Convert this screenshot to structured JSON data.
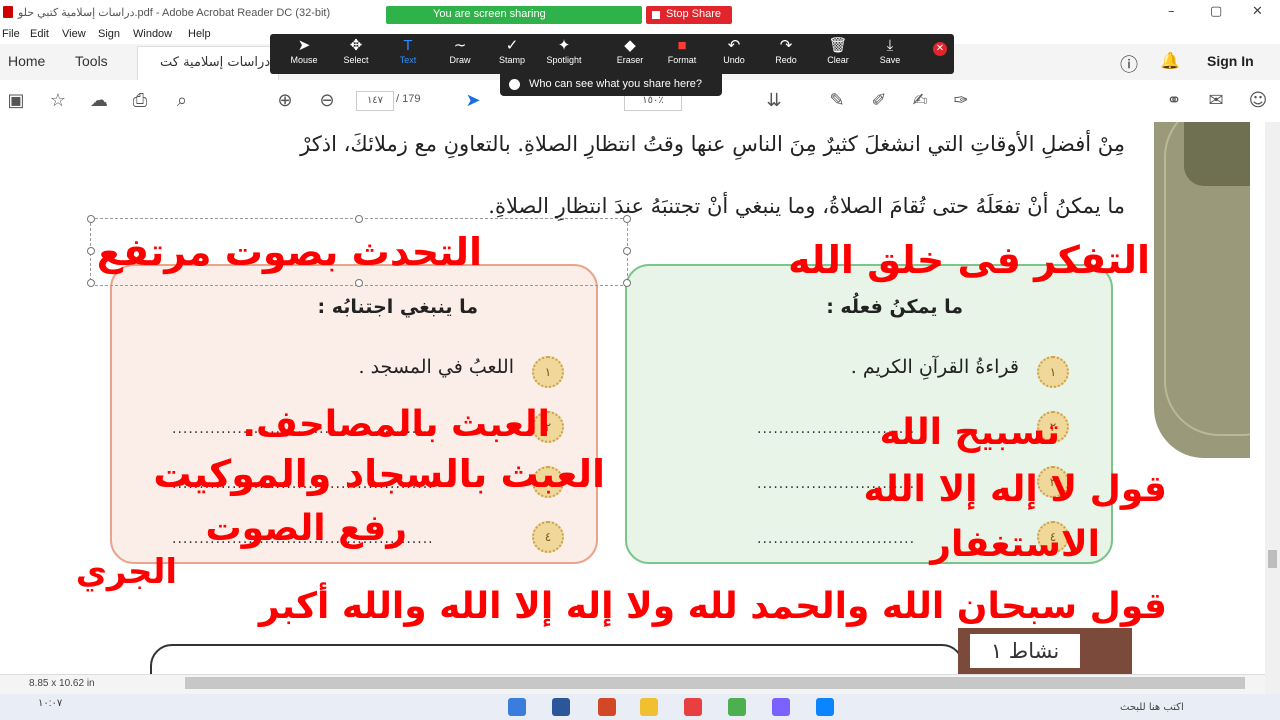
{
  "window": {
    "title": "دراسات إسلامية كتبي حلو.pdf - Adobe Acrobat Reader DC (32-bit)",
    "minimize": "–",
    "maximize": "▢",
    "close": "✕"
  },
  "share": {
    "banner": "You are screen sharing",
    "stop": "Stop Share",
    "who": "Who can see what you share here?"
  },
  "menu": [
    "File",
    "Edit",
    "View",
    "Sign",
    "Window",
    "Help"
  ],
  "tabs": {
    "home": "Home",
    "tools": "Tools",
    "document": "دراسات إسلامية كت...",
    "sign_in": "Sign In"
  },
  "annotation_tools": [
    {
      "label": "Mouse",
      "glyph": "➤",
      "icon": "mouse-pointer-icon"
    },
    {
      "label": "Select",
      "glyph": "✥",
      "icon": "select-icon"
    },
    {
      "label": "Text",
      "glyph": "T",
      "icon": "text-icon"
    },
    {
      "label": "Draw",
      "glyph": "∼",
      "icon": "draw-icon"
    },
    {
      "label": "Stamp",
      "glyph": "✓",
      "icon": "stamp-icon"
    },
    {
      "label": "Spotlight",
      "glyph": "✦",
      "icon": "spotlight-icon"
    },
    {
      "label": "Eraser",
      "glyph": "◆",
      "icon": "eraser-icon"
    },
    {
      "label": "Format",
      "glyph": "■",
      "icon": "format-icon"
    },
    {
      "label": "Undo",
      "glyph": "↶",
      "icon": "undo-icon"
    },
    {
      "label": "Redo",
      "glyph": "↷",
      "icon": "redo-icon"
    },
    {
      "label": "Clear",
      "glyph": "🗑",
      "icon": "trash-icon"
    },
    {
      "label": "Save",
      "glyph": "⤓",
      "icon": "save-icon"
    }
  ],
  "accent": {
    "active_tool": "#2d8cff",
    "format_red": "#ff3b30",
    "share_green": "#2fb24a",
    "stop_red": "#e0262c",
    "ink_red": "#ff0000"
  },
  "toolbar": {
    "page_current": "١٤٧",
    "page_total": "/ 179",
    "zoom": "١٥٠٪"
  },
  "document": {
    "line1": "مِنْ أفضلِ الأوقاتِ التي انشغلَ كثيرٌ مِنَ الناسِ عنها وقتُ انتظارِ الصلاةِ. بالتعاونِ مع زملائكَ، اذكرْ",
    "line2": "ما يمكنُ أنْ تفعَلَهُ حتى تُقامَ الصلاةُ، وما ينبغي أنْ تجتنبَهُ عندَ انتظارِ الصلاةِ.",
    "right_box": {
      "title": "ما يمكنُ فعلُه :",
      "item1": "قراءةُ القرآنِ الكريم .",
      "badges": [
        "١",
        "٢",
        "٣",
        "٤"
      ],
      "dots": "............................."
    },
    "left_box": {
      "title": "ما ينبغي اجتنابُه :",
      "item1": "اللعبُ في المسجد .",
      "badges": [
        "١",
        "٢",
        "٣",
        "٤"
      ],
      "dots": "................................................"
    },
    "activity_label": "نشاط ١"
  },
  "handwritten": {
    "left_top": "التحدث بصوت مرتفع",
    "right_top": "التفكر فى خلق الله",
    "left2": "العبث بالمصاحف.",
    "left3": "العبث بالسجاد والموكيت",
    "left4": "رفع الصوت",
    "left5": "الجري",
    "right2": "تسبيح الله",
    "right3": "قول لا إله إلا الله",
    "right4": "الاستغفار",
    "bottom": "قول سبحان الله والحمد لله ولا إله إلا الله والله أكبر"
  },
  "status": {
    "page_size": "8.85 x 10.62 in"
  },
  "taskbar": {
    "clock": "١٠:٠٧",
    "search_hint": "اكتب هنا للبحث"
  }
}
